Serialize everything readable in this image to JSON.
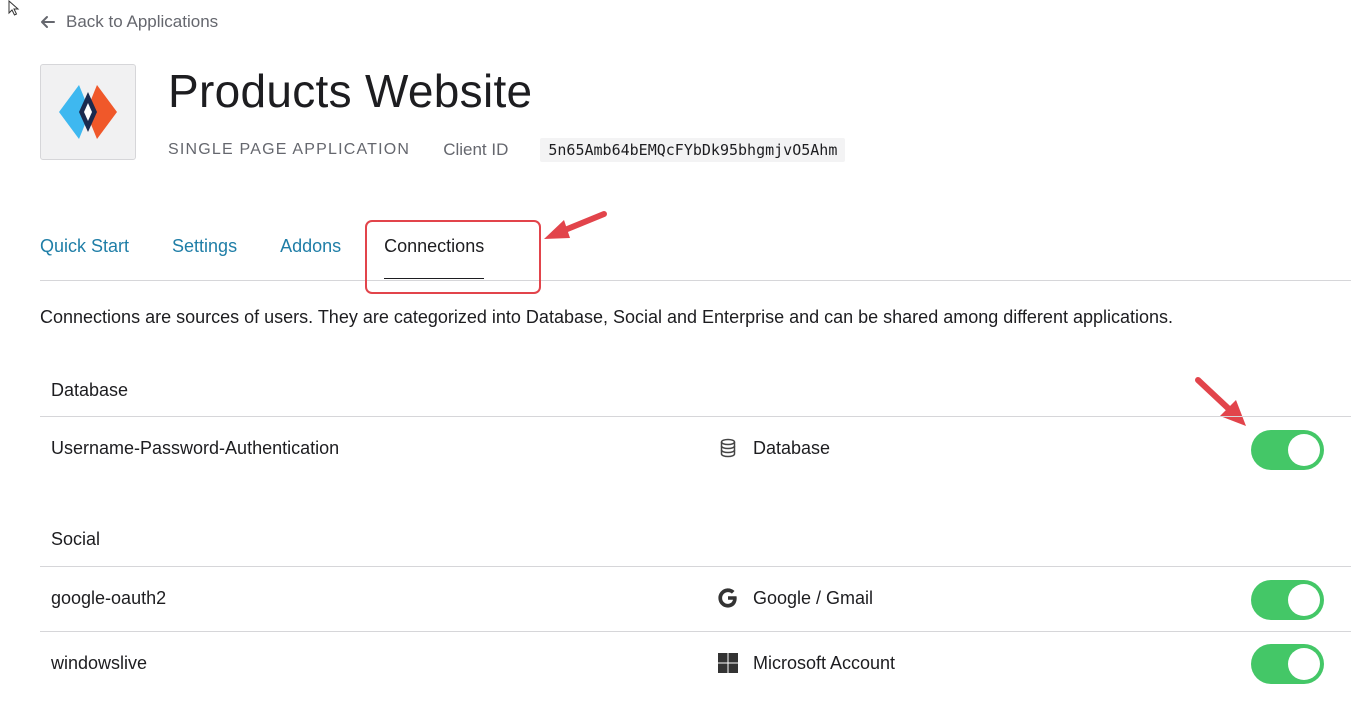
{
  "nav": {
    "back_label": "Back to Applications"
  },
  "app": {
    "title": "Products Website",
    "type": "SINGLE PAGE APPLICATION",
    "client_id_label": "Client ID",
    "client_id": "5n65Amb64bEMQcFYbDk95bhgmjvO5Ahm"
  },
  "tabs": [
    {
      "label": "Quick Start",
      "active": false
    },
    {
      "label": "Settings",
      "active": false
    },
    {
      "label": "Addons",
      "active": false
    },
    {
      "label": "Connections",
      "active": true
    }
  ],
  "description": "Connections are sources of users. They are categorized into Database, Social and Enterprise and can be shared among different applications.",
  "sections": [
    {
      "title": "Database",
      "rows": [
        {
          "name": "Username-Password-Authentication",
          "type": "Database",
          "icon": "database-icon",
          "enabled": true
        }
      ]
    },
    {
      "title": "Social",
      "rows": [
        {
          "name": "google-oauth2",
          "type": "Google / Gmail",
          "icon": "google-icon",
          "enabled": true
        },
        {
          "name": "windowslive",
          "type": "Microsoft Account",
          "icon": "windows-icon",
          "enabled": true
        }
      ]
    }
  ],
  "colors": {
    "link": "#1f7ea7",
    "toggle_on": "#44c767",
    "annotation": "#e2444b"
  }
}
